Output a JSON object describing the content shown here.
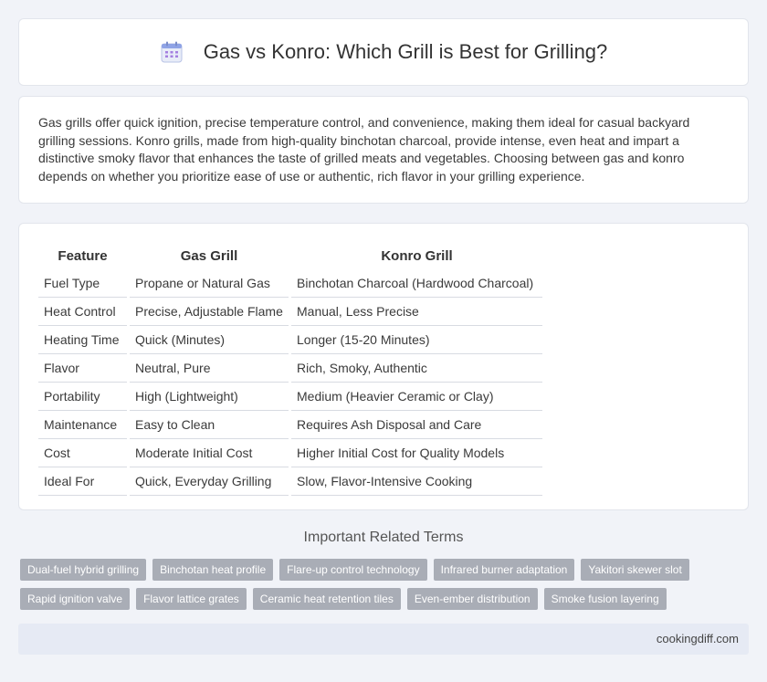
{
  "header": {
    "title": "Gas vs Konro: Which Grill is Best for Grilling?",
    "icon": "calendar-icon"
  },
  "intro": {
    "text": "Gas grills offer quick ignition, precise temperature control, and convenience, making them ideal for casual backyard grilling sessions. Konro grills, made from high-quality binchotan charcoal, provide intense, even heat and impart a distinctive smoky flavor that enhances the taste of grilled meats and vegetables. Choosing between gas and konro depends on whether you prioritize ease of use or authentic, rich flavor in your grilling experience."
  },
  "table": {
    "headers": [
      "Feature",
      "Gas Grill",
      "Konro Grill"
    ],
    "rows": [
      [
        "Fuel Type",
        "Propane or Natural Gas",
        "Binchotan Charcoal (Hardwood Charcoal)"
      ],
      [
        "Heat Control",
        "Precise, Adjustable Flame",
        "Manual, Less Precise"
      ],
      [
        "Heating Time",
        "Quick (Minutes)",
        "Longer (15-20 Minutes)"
      ],
      [
        "Flavor",
        "Neutral, Pure",
        "Rich, Smoky, Authentic"
      ],
      [
        "Portability",
        "High (Lightweight)",
        "Medium (Heavier Ceramic or Clay)"
      ],
      [
        "Maintenance",
        "Easy to Clean",
        "Requires Ash Disposal and Care"
      ],
      [
        "Cost",
        "Moderate Initial Cost",
        "Higher Initial Cost for Quality Models"
      ],
      [
        "Ideal For",
        "Quick, Everyday Grilling",
        "Slow, Flavor-Intensive Cooking"
      ]
    ]
  },
  "related": {
    "title": "Important Related Terms",
    "rows": [
      [
        "Dual-fuel hybrid grilling",
        "Binchotan heat profile",
        "Flare-up control technology",
        "Infrared burner adaptation",
        "Yakitori skewer slot"
      ],
      [
        "Rapid ignition valve",
        "Flavor lattice grates",
        "Ceramic heat retention tiles",
        "Even-ember distribution",
        "Smoke fusion layering"
      ]
    ]
  },
  "footer": {
    "site": "cookingdiff.com"
  },
  "colors": {
    "background": "#f1f3f8",
    "tag": "#a9adb6",
    "footer": "#e6eaf4"
  }
}
